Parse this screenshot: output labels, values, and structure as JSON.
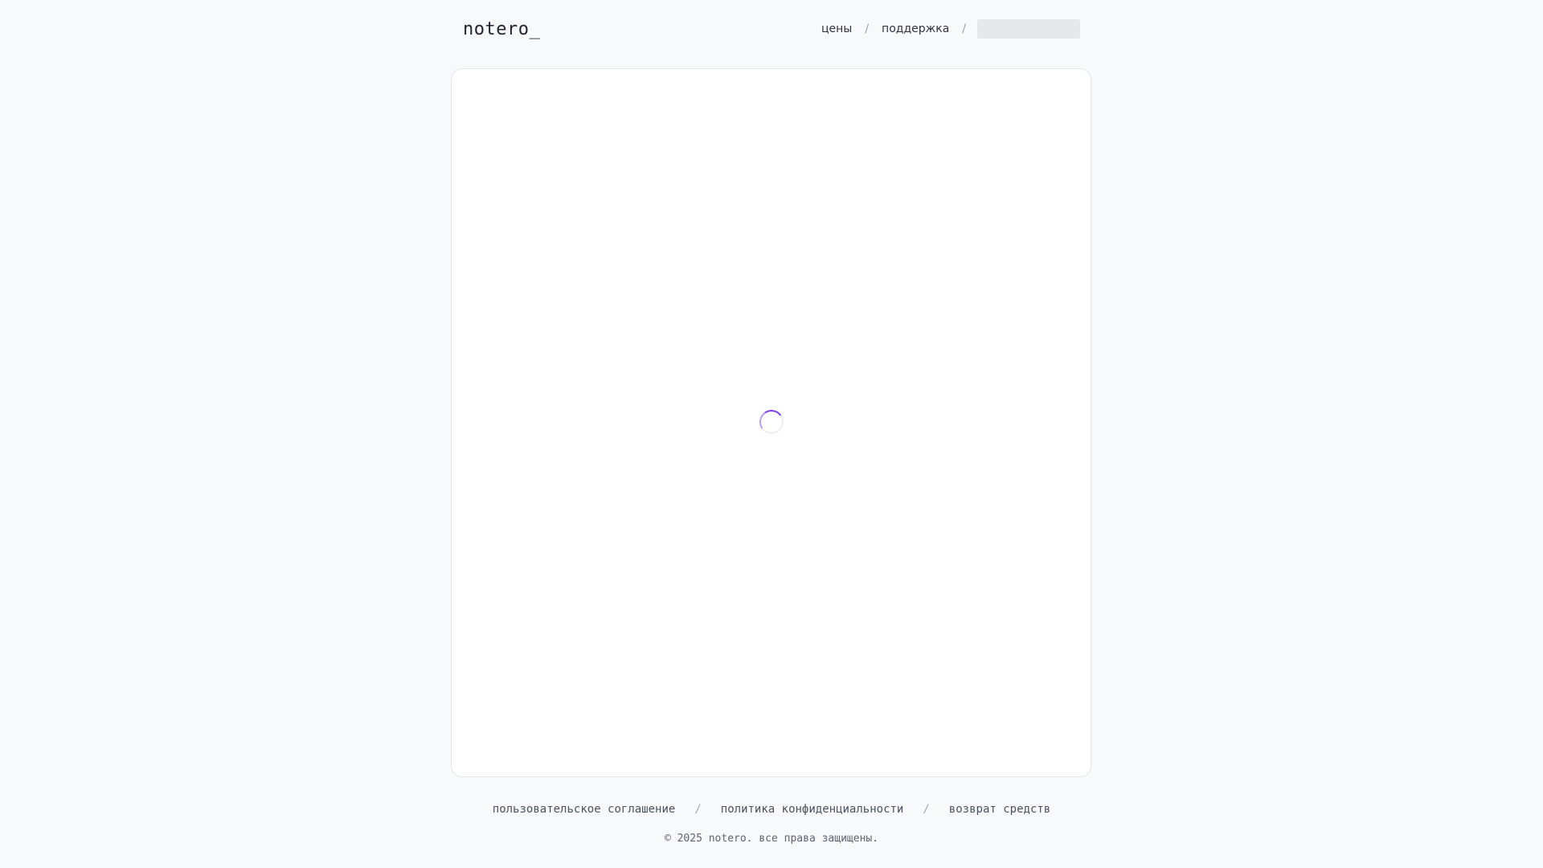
{
  "header": {
    "logo": "notero_",
    "nav": {
      "pricing": "цены",
      "support": "поддержка",
      "separator": "/"
    }
  },
  "main": {
    "state": "loading",
    "spinner_icon": "loading-spinner-icon",
    "accent_color": "#7c3aed"
  },
  "footer": {
    "links": {
      "terms": "пользовательское соглашение",
      "privacy": "политика конфиденциальности",
      "refund": "возврат средств"
    },
    "separator": "/",
    "copyright": "© 2025 notero. все права защищены."
  }
}
